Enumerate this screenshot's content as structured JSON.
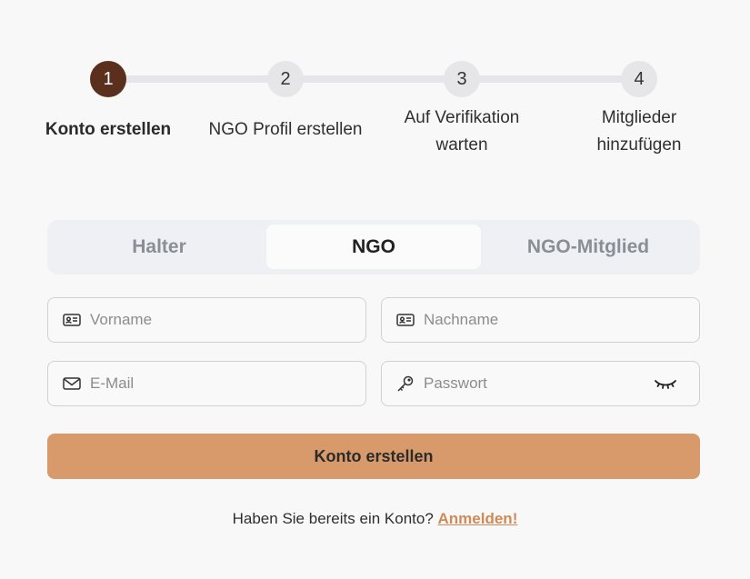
{
  "stepper": {
    "steps": [
      {
        "number": "1",
        "label": "Konto erstellen"
      },
      {
        "number": "2",
        "label": "NGO Profil erstellen"
      },
      {
        "number": "3",
        "label_line1": "Auf Verifikation",
        "label_line2": "warten"
      },
      {
        "number": "4",
        "label_line1": "Mitglieder",
        "label_line2": "hinzufügen"
      }
    ],
    "active_step": 1
  },
  "tabs": [
    {
      "label": "Halter"
    },
    {
      "label": "NGO"
    },
    {
      "label": "NGO-Mitglied"
    }
  ],
  "active_tab": "NGO",
  "form": {
    "vorname": {
      "placeholder": "Vorname",
      "value": ""
    },
    "nachname": {
      "placeholder": "Nachname",
      "value": ""
    },
    "email": {
      "placeholder": "E-Mail",
      "value": ""
    },
    "passwort": {
      "placeholder": "Passwort",
      "value": ""
    },
    "submit_label": "Konto erstellen"
  },
  "login_prompt": {
    "text": "Haben Sie bereits ein Konto?",
    "link_label": "Anmelden!"
  },
  "colors": {
    "active_step": "#5a2f1e",
    "button": "#d89a6a",
    "link": "#d08a58"
  },
  "icons": {
    "vorname": "id-card-icon",
    "nachname": "id-card-icon",
    "email": "mail-icon",
    "passwort": "key-icon",
    "toggle_visibility": "eye-closed-icon"
  }
}
